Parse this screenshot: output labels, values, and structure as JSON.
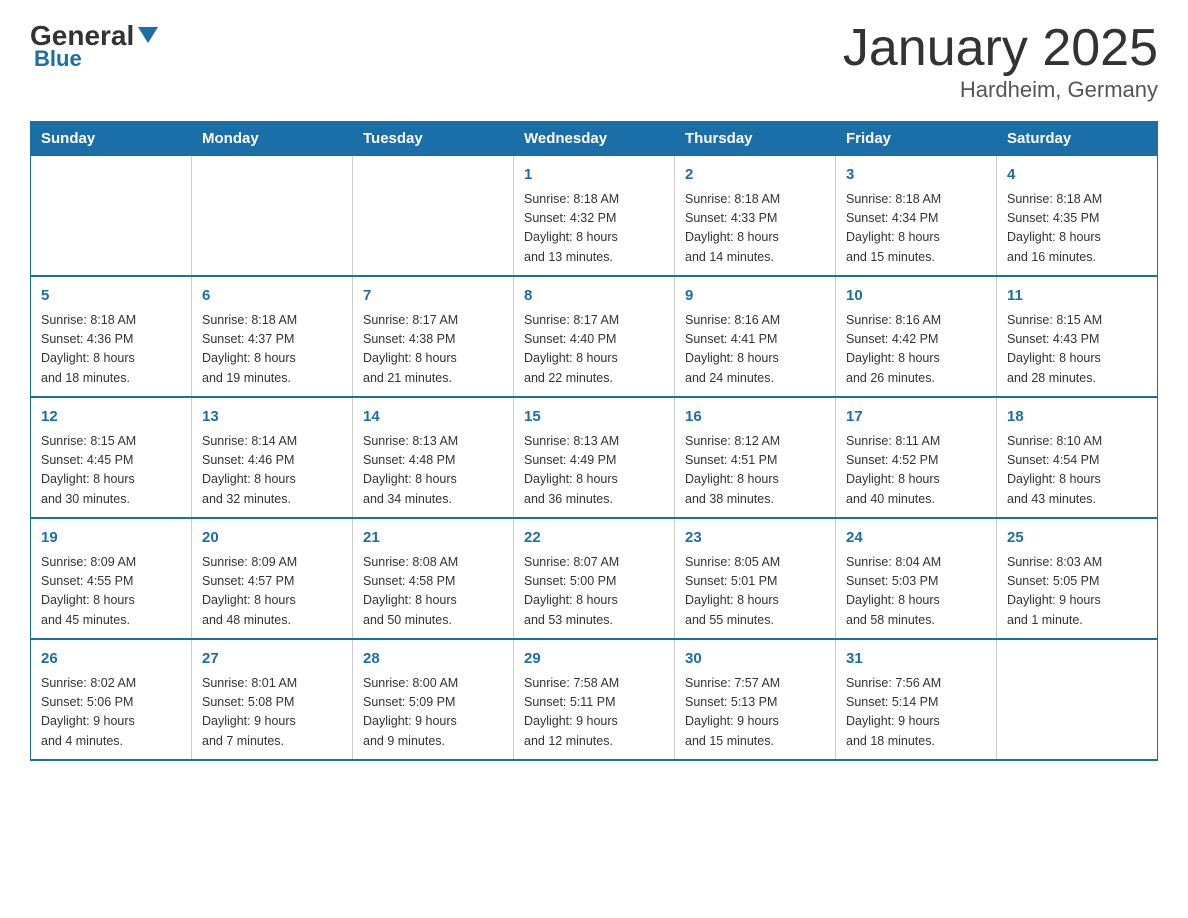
{
  "header": {
    "logo_general": "General",
    "logo_blue": "Blue",
    "title": "January 2025",
    "subtitle": "Hardheim, Germany"
  },
  "days": [
    "Sunday",
    "Monday",
    "Tuesday",
    "Wednesday",
    "Thursday",
    "Friday",
    "Saturday"
  ],
  "weeks": [
    [
      {
        "day": "",
        "info": ""
      },
      {
        "day": "",
        "info": ""
      },
      {
        "day": "",
        "info": ""
      },
      {
        "day": "1",
        "info": "Sunrise: 8:18 AM\nSunset: 4:32 PM\nDaylight: 8 hours\nand 13 minutes."
      },
      {
        "day": "2",
        "info": "Sunrise: 8:18 AM\nSunset: 4:33 PM\nDaylight: 8 hours\nand 14 minutes."
      },
      {
        "day": "3",
        "info": "Sunrise: 8:18 AM\nSunset: 4:34 PM\nDaylight: 8 hours\nand 15 minutes."
      },
      {
        "day": "4",
        "info": "Sunrise: 8:18 AM\nSunset: 4:35 PM\nDaylight: 8 hours\nand 16 minutes."
      }
    ],
    [
      {
        "day": "5",
        "info": "Sunrise: 8:18 AM\nSunset: 4:36 PM\nDaylight: 8 hours\nand 18 minutes."
      },
      {
        "day": "6",
        "info": "Sunrise: 8:18 AM\nSunset: 4:37 PM\nDaylight: 8 hours\nand 19 minutes."
      },
      {
        "day": "7",
        "info": "Sunrise: 8:17 AM\nSunset: 4:38 PM\nDaylight: 8 hours\nand 21 minutes."
      },
      {
        "day": "8",
        "info": "Sunrise: 8:17 AM\nSunset: 4:40 PM\nDaylight: 8 hours\nand 22 minutes."
      },
      {
        "day": "9",
        "info": "Sunrise: 8:16 AM\nSunset: 4:41 PM\nDaylight: 8 hours\nand 24 minutes."
      },
      {
        "day": "10",
        "info": "Sunrise: 8:16 AM\nSunset: 4:42 PM\nDaylight: 8 hours\nand 26 minutes."
      },
      {
        "day": "11",
        "info": "Sunrise: 8:15 AM\nSunset: 4:43 PM\nDaylight: 8 hours\nand 28 minutes."
      }
    ],
    [
      {
        "day": "12",
        "info": "Sunrise: 8:15 AM\nSunset: 4:45 PM\nDaylight: 8 hours\nand 30 minutes."
      },
      {
        "day": "13",
        "info": "Sunrise: 8:14 AM\nSunset: 4:46 PM\nDaylight: 8 hours\nand 32 minutes."
      },
      {
        "day": "14",
        "info": "Sunrise: 8:13 AM\nSunset: 4:48 PM\nDaylight: 8 hours\nand 34 minutes."
      },
      {
        "day": "15",
        "info": "Sunrise: 8:13 AM\nSunset: 4:49 PM\nDaylight: 8 hours\nand 36 minutes."
      },
      {
        "day": "16",
        "info": "Sunrise: 8:12 AM\nSunset: 4:51 PM\nDaylight: 8 hours\nand 38 minutes."
      },
      {
        "day": "17",
        "info": "Sunrise: 8:11 AM\nSunset: 4:52 PM\nDaylight: 8 hours\nand 40 minutes."
      },
      {
        "day": "18",
        "info": "Sunrise: 8:10 AM\nSunset: 4:54 PM\nDaylight: 8 hours\nand 43 minutes."
      }
    ],
    [
      {
        "day": "19",
        "info": "Sunrise: 8:09 AM\nSunset: 4:55 PM\nDaylight: 8 hours\nand 45 minutes."
      },
      {
        "day": "20",
        "info": "Sunrise: 8:09 AM\nSunset: 4:57 PM\nDaylight: 8 hours\nand 48 minutes."
      },
      {
        "day": "21",
        "info": "Sunrise: 8:08 AM\nSunset: 4:58 PM\nDaylight: 8 hours\nand 50 minutes."
      },
      {
        "day": "22",
        "info": "Sunrise: 8:07 AM\nSunset: 5:00 PM\nDaylight: 8 hours\nand 53 minutes."
      },
      {
        "day": "23",
        "info": "Sunrise: 8:05 AM\nSunset: 5:01 PM\nDaylight: 8 hours\nand 55 minutes."
      },
      {
        "day": "24",
        "info": "Sunrise: 8:04 AM\nSunset: 5:03 PM\nDaylight: 8 hours\nand 58 minutes."
      },
      {
        "day": "25",
        "info": "Sunrise: 8:03 AM\nSunset: 5:05 PM\nDaylight: 9 hours\nand 1 minute."
      }
    ],
    [
      {
        "day": "26",
        "info": "Sunrise: 8:02 AM\nSunset: 5:06 PM\nDaylight: 9 hours\nand 4 minutes."
      },
      {
        "day": "27",
        "info": "Sunrise: 8:01 AM\nSunset: 5:08 PM\nDaylight: 9 hours\nand 7 minutes."
      },
      {
        "day": "28",
        "info": "Sunrise: 8:00 AM\nSunset: 5:09 PM\nDaylight: 9 hours\nand 9 minutes."
      },
      {
        "day": "29",
        "info": "Sunrise: 7:58 AM\nSunset: 5:11 PM\nDaylight: 9 hours\nand 12 minutes."
      },
      {
        "day": "30",
        "info": "Sunrise: 7:57 AM\nSunset: 5:13 PM\nDaylight: 9 hours\nand 15 minutes."
      },
      {
        "day": "31",
        "info": "Sunrise: 7:56 AM\nSunset: 5:14 PM\nDaylight: 9 hours\nand 18 minutes."
      },
      {
        "day": "",
        "info": ""
      }
    ]
  ]
}
